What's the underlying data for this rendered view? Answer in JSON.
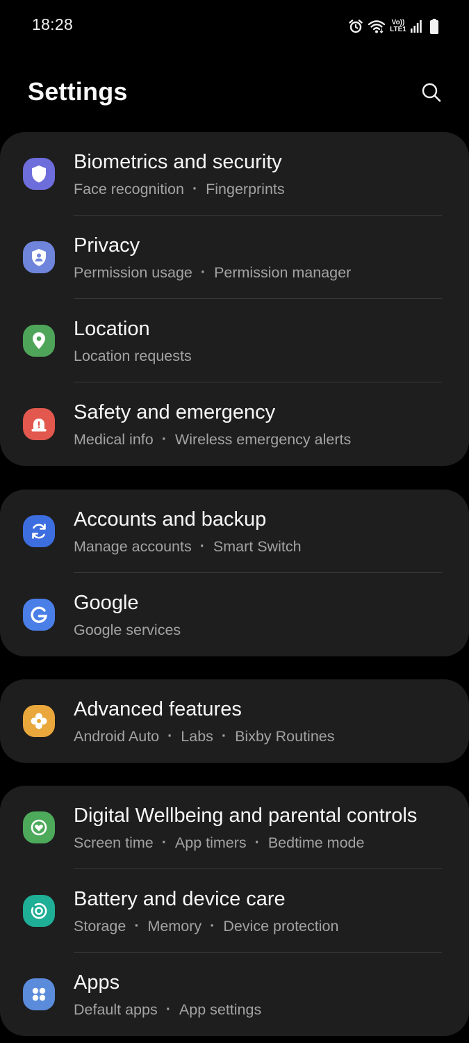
{
  "status_bar": {
    "time": "18:28",
    "network_top": "Vo))",
    "network_bottom": "LTE1"
  },
  "header": {
    "title": "Settings",
    "search_icon": "search-icon"
  },
  "colors": {
    "background": "#000000",
    "card": "#1e1e1e",
    "title_text": "#f7f7f7",
    "subtitle_text": "#a3a3a3",
    "divider": "#3a3a3a"
  },
  "groups": [
    {
      "items": [
        {
          "id": "biometrics",
          "title": "Biometrics and security",
          "subtitle": [
            "Face recognition",
            "Fingerprints"
          ],
          "icon": "shield-icon",
          "color": "#6e6ddc"
        },
        {
          "id": "privacy",
          "title": "Privacy",
          "subtitle": [
            "Permission usage",
            "Permission manager"
          ],
          "icon": "privacy-shield-icon",
          "color": "#6f85dc"
        },
        {
          "id": "location",
          "title": "Location",
          "subtitle": [
            "Location requests"
          ],
          "icon": "location-pin-icon",
          "color": "#4ea55a"
        },
        {
          "id": "safety",
          "title": "Safety and emergency",
          "subtitle": [
            "Medical info",
            "Wireless emergency alerts"
          ],
          "icon": "emergency-alert-icon",
          "color": "#e2584e"
        }
      ]
    },
    {
      "items": [
        {
          "id": "accounts",
          "title": "Accounts and backup",
          "subtitle": [
            "Manage accounts",
            "Smart Switch"
          ],
          "icon": "sync-icon",
          "color": "#3d6ee0"
        },
        {
          "id": "google",
          "title": "Google",
          "subtitle": [
            "Google services"
          ],
          "icon": "google-icon",
          "color": "#4a7fe8"
        }
      ]
    },
    {
      "items": [
        {
          "id": "advanced",
          "title": "Advanced features",
          "subtitle": [
            "Android Auto",
            "Labs",
            "Bixby Routines"
          ],
          "icon": "puzzle-icon",
          "color": "#e9a73c"
        }
      ]
    },
    {
      "items": [
        {
          "id": "wellbeing",
          "title": "Digital Wellbeing and parental controls",
          "subtitle": [
            "Screen time",
            "App timers",
            "Bedtime mode"
          ],
          "icon": "heart-ring-icon",
          "color": "#4daa5b"
        },
        {
          "id": "battery",
          "title": "Battery and device care",
          "subtitle": [
            "Storage",
            "Memory",
            "Device protection"
          ],
          "icon": "device-care-icon",
          "color": "#1fae96"
        },
        {
          "id": "apps",
          "title": "Apps",
          "subtitle": [
            "Default apps",
            "App settings"
          ],
          "icon": "apps-grid-icon",
          "color": "#5b8cdc"
        }
      ]
    }
  ]
}
